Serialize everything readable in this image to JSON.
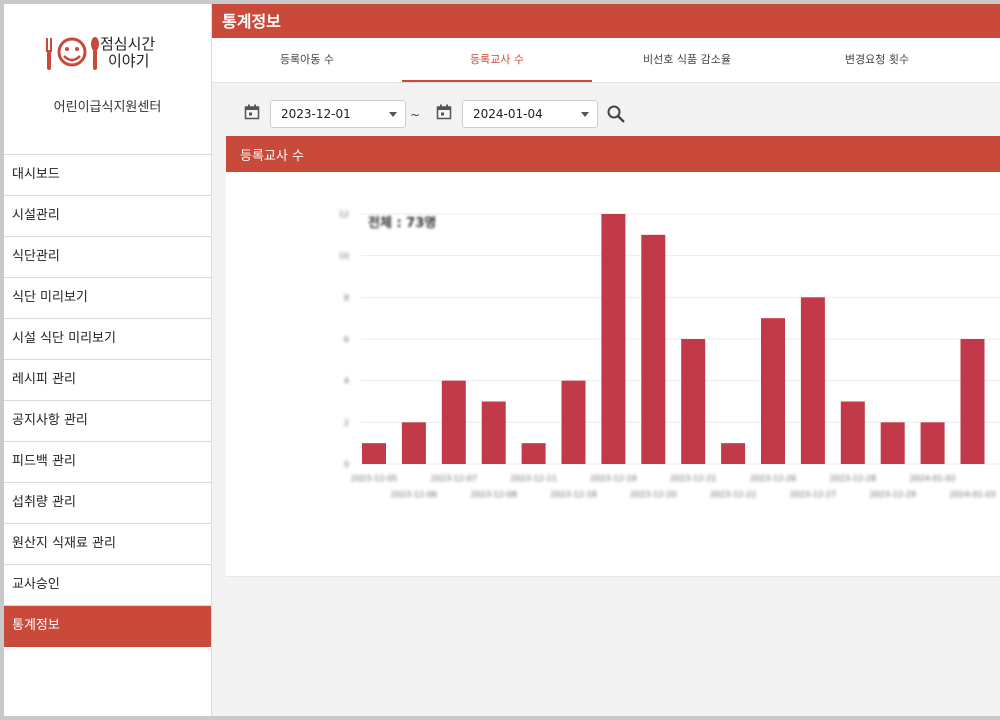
{
  "sidebar": {
    "logo_line1": "점심시간",
    "logo_line2": "이야기",
    "org_name": "어린이급식지원센터",
    "items": [
      {
        "label": "대시보드"
      },
      {
        "label": "시설관리"
      },
      {
        "label": "식단관리"
      },
      {
        "label": "식단 미리보기"
      },
      {
        "label": "시설 식단 미리보기"
      },
      {
        "label": "레시피 관리"
      },
      {
        "label": "공지사항 관리"
      },
      {
        "label": "피드백 관리"
      },
      {
        "label": "섭취량 관리"
      },
      {
        "label": "원산지 식재료 관리"
      },
      {
        "label": "교사승인"
      },
      {
        "label": "통계정보",
        "active": true
      }
    ]
  },
  "page": {
    "title": "통계정보"
  },
  "tabs": [
    {
      "label": "등록아동 수"
    },
    {
      "label": "등록교사 수",
      "active": true
    },
    {
      "label": "비선호 식품 감소율"
    },
    {
      "label": "변경요청 횟수"
    }
  ],
  "filters": {
    "start_date": "2023-12-01",
    "end_date": "2024-01-04",
    "separator": "~"
  },
  "card": {
    "title": "등록교사 수",
    "total_label": "전체 : 73명"
  },
  "colors": {
    "brand": "#c94a3a",
    "bar": "#c2394a"
  },
  "chart_data": {
    "type": "bar",
    "categories": [
      "2023-12-05",
      "2023-12-06",
      "2023-12-07",
      "2023-12-08",
      "2023-12-11",
      "2023-12-18",
      "2023-12-19",
      "2023-12-20",
      "2023-12-21",
      "2023-12-22",
      "2023-12-26",
      "2023-12-27",
      "2023-12-28",
      "2023-12-29",
      "2024-01-02",
      "2024-01-03"
    ],
    "values": [
      1,
      2,
      4,
      3,
      1,
      4,
      12,
      11,
      6,
      1,
      7,
      8,
      3,
      2,
      2,
      6
    ],
    "yticks": [
      "0",
      "2",
      "4",
      "6",
      "8",
      "10",
      "12"
    ],
    "ylim": [
      0,
      12
    ],
    "grid": true
  }
}
